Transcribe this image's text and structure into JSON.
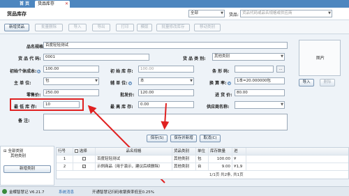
{
  "tabs": {
    "home": "首 页",
    "active": "货品库存",
    "close": "✕"
  },
  "title": "货品库存",
  "header": {
    "filter_select": "全部",
    "goods_label": "货品:",
    "goods_placeholder": "货品代码或品名规格或供应商"
  },
  "toolbar": [
    "新增货品",
    "批量删除",
    "导入",
    "导出",
    "打印",
    "模版",
    "批量修改库存",
    "移动类别"
  ],
  "form": {
    "name_label": "品名规格:",
    "name_value": "百度轻轻测试",
    "code_label": "货 品 代 码:",
    "code_value": "0001",
    "category_label": "货 品 类 别:",
    "category_value": "其他类别",
    "init_cost_label": "初始个体成本:",
    "init_cost_value": "100.00",
    "init_stock_label": "初 始 库 存:",
    "init_stock_value": "100.00",
    "barcode_label": "条 形 码:",
    "barcode_value": "",
    "dots": "...",
    "main_unit_label": "主  单  位:",
    "main_unit_value": "包",
    "sub_unit_label": "辅 单 位:",
    "sub_unit_value": "本",
    "convert_label": "换 算 率:",
    "convert_value": "1本=20.000000包",
    "retail_label": "零售价:",
    "retail_value": "250.00",
    "wholesale_label": "批发价:",
    "wholesale_value": "120.00",
    "purchase_label": "进  货  价:",
    "purchase_value": "80.00",
    "min_stock_label": "最 低 库 存:",
    "min_stock_value": "10",
    "max_stock_label": "最 高 库 存:",
    "max_stock_value": "0.00",
    "supplier_label": "供应商名称:",
    "supplier_value": "",
    "notes_label": "备    注:",
    "image_label": "图片",
    "import_btn": "导入",
    "delete_btn": "删除"
  },
  "actions": {
    "save": "保存(S)",
    "save_new": "保存并新增",
    "cancel": "取消(C)"
  },
  "tree": {
    "root": "全部类别",
    "child": "其他类别",
    "new_category": "新增类别"
  },
  "table": {
    "headers": [
      "行号",
      "选择",
      "品名规格",
      "货品类别",
      "单位",
      "库存数量",
      "进"
    ],
    "rows": [
      {
        "no": "1",
        "name": "百度轻轻测试",
        "category": "其他类别",
        "unit": "包",
        "qty": "100.00",
        "price": "¥"
      },
      {
        "no": "2",
        "name": "示例商品（用于演示，建议后续删除）",
        "category": "其他类别",
        "unit": "台",
        "qty": "9.00",
        "price": "¥1,9"
      }
    ],
    "pager": "1/1页 共2条, 共1页"
  },
  "status": {
    "app": "金蝶智慧记 V6.21.7",
    "link": "系统消息",
    "message": "开通智慧记扫码收银费率低至0.25%"
  },
  "colors": {
    "titlebar": "#4d86bf",
    "highlight": "#e02020",
    "arrow": "#e02020"
  }
}
